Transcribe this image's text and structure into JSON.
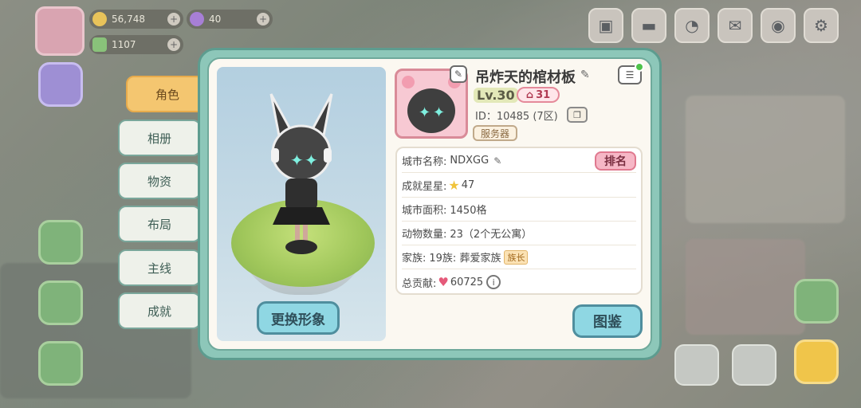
{
  "hud": {
    "coins": "56,748",
    "gems": "40",
    "cash": "1107"
  },
  "tabs": [
    {
      "label": "角色",
      "active": true
    },
    {
      "label": "相册",
      "active": false
    },
    {
      "label": "物资",
      "active": false
    },
    {
      "label": "布局",
      "active": false
    },
    {
      "label": "主线",
      "active": false
    },
    {
      "label": "成就",
      "active": false
    }
  ],
  "profile": {
    "name": "吊炸天的棺材板",
    "level": "Lv.30",
    "home_level": "31",
    "id_text": "ID：10485 (7区)",
    "server_label": "服务器",
    "change_look_label": "更换形象",
    "atlas_label": "图鉴",
    "rank_label": "排名"
  },
  "info_rows": {
    "city_name_label": "城市名称:",
    "city_name_value": "NDXGG",
    "stars_label": "成就星星:",
    "stars_value": "47",
    "area_label": "城市面积:",
    "area_value": "1450格",
    "animals_label": "动物数量:",
    "animals_value": "23（2个无公寓）",
    "clan_label": "家族:",
    "clan_value": "19族: 葬爱家族",
    "clan_role": "族长",
    "contribution_label": "总贡献:",
    "contribution_value": "60725"
  },
  "colors": {
    "panel_border": "#5d9c8f",
    "tab_active": "#f4c670",
    "button_teal": "#8fd7e3",
    "rank_pink": "#f6b7c6"
  }
}
